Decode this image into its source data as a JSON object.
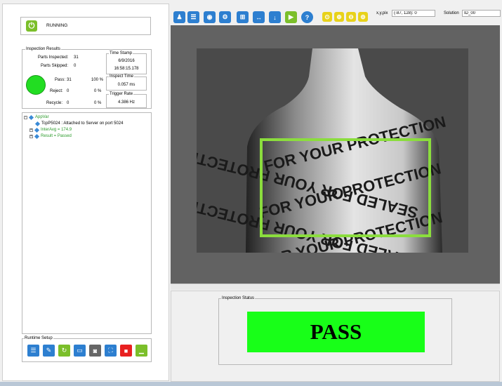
{
  "status": {
    "label": "RUNNING"
  },
  "inspection_results": {
    "title": "Inspection Results",
    "parts_inspected_label": "Parts Inspected:",
    "parts_inspected": "31",
    "parts_skipped_label": "Parts Skipped:",
    "parts_skipped": "0",
    "pass_label": "Pass:",
    "pass_count": "31",
    "pass_pct": "100 %",
    "reject_label": "Reject:",
    "reject_count": "0",
    "reject_pct": "0 %",
    "recycle_label": "Recycle:",
    "recycle_count": "0",
    "recycle_pct": "0 %",
    "status_color": "#22dd22",
    "timestamp_title": "Time Stamp",
    "timestamp_date": "6/9/2016",
    "timestamp_time": "16:58:15.178",
    "inspect_time_title": "Inspect Time",
    "inspect_time": "0.057 ms",
    "trigger_rate_title": "Trigger Rate",
    "trigger_rate": "4.386 Hz"
  },
  "tree": {
    "root": "AppVar",
    "items": [
      "TcpP5024 : Attached to Server on port 5024",
      "InterAvg = 174.9",
      "Result = Passed"
    ]
  },
  "runtime_setup": {
    "title": "Runtime Setup"
  },
  "toolbar": {
    "coord_label": "x,y,pix",
    "coord_value": "(-87, 128): 0",
    "solution_label": "Solution",
    "solution_value": "ID_00"
  },
  "image_text": {
    "line1": "FOR YOUR PROTECTION",
    "line2": "SEALED FOR YOUR PROTECTION",
    "line3": "FOR YOUR PROTECTION",
    "line4": "SEALED FOR YOUR PROTECTION",
    "line5": "FOR YOUR PROTECTION"
  },
  "inspection_status": {
    "title": "Inspection Status",
    "result": "PASS",
    "result_color": "#18ff18"
  },
  "colors": {
    "accent_blue": "#2d7fd0",
    "accent_green": "#7bbf2a",
    "roi_green": "#8bdd3d"
  }
}
